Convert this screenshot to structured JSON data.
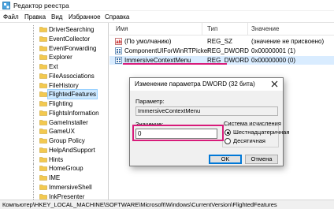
{
  "window": {
    "title": "Редактор реестра"
  },
  "menu": [
    "Файл",
    "Правка",
    "Вид",
    "Избранное",
    "Справка"
  ],
  "tree": {
    "items": [
      {
        "label": "DriverSearching",
        "selected": false
      },
      {
        "label": "EventCollector",
        "selected": false
      },
      {
        "label": "EventForwarding",
        "selected": false
      },
      {
        "label": "Explorer",
        "selected": false
      },
      {
        "label": "Ext",
        "selected": false
      },
      {
        "label": "FileAssociations",
        "selected": false
      },
      {
        "label": "FileHistory",
        "selected": false
      },
      {
        "label": "FlightedFeatures",
        "selected": true
      },
      {
        "label": "Flighting",
        "selected": false
      },
      {
        "label": "FlightsInformation",
        "selected": false
      },
      {
        "label": "GameInstaller",
        "selected": false
      },
      {
        "label": "GameUX",
        "selected": false
      },
      {
        "label": "Group Policy",
        "selected": false
      },
      {
        "label": "HelpAndSupport",
        "selected": false
      },
      {
        "label": "Hints",
        "selected": false
      },
      {
        "label": "HomeGroup",
        "selected": false
      },
      {
        "label": "IME",
        "selected": false
      },
      {
        "label": "ImmersiveShell",
        "selected": false
      },
      {
        "label": "InkPresenter",
        "selected": false
      }
    ]
  },
  "list": {
    "headers": {
      "name": "Имя",
      "type": "Тип",
      "value": "Значение"
    },
    "rows": [
      {
        "icon": "string-value-icon",
        "name": "(По умолчанию)",
        "type": "REG_SZ",
        "value": "(значение не присвоено)"
      },
      {
        "icon": "binary-value-icon",
        "name": "ComponentUIForWinRTPicker",
        "type": "REG_DWORD",
        "value": "0x00000001 (1)"
      },
      {
        "icon": "binary-value-icon",
        "name": "ImmersiveContextMenu",
        "type": "REG_DWORD",
        "value": "0x00000000 (0)"
      }
    ]
  },
  "statusbar": {
    "path": "Компьютер\\HKEY_LOCAL_MACHINE\\SOFTWARE\\Microsoft\\Windows\\CurrentVersion\\FlightedFeatures"
  },
  "dialog": {
    "title": "Изменение параметра DWORD (32 бита)",
    "param_label": "Параметр:",
    "param_value": "ImmersiveContextMenu",
    "value_label": "Значение:",
    "value": "0",
    "base_label": "Система исчисления",
    "base_options": [
      {
        "label": "Шестнадцатеричная",
        "checked": true
      },
      {
        "label": "Десятичная",
        "checked": false
      }
    ],
    "ok_label": "OK",
    "cancel_label": "Отмена"
  },
  "colors": {
    "highlight": "#d81b7a",
    "selection": "#cce8ff",
    "accent": "#0078d7"
  }
}
